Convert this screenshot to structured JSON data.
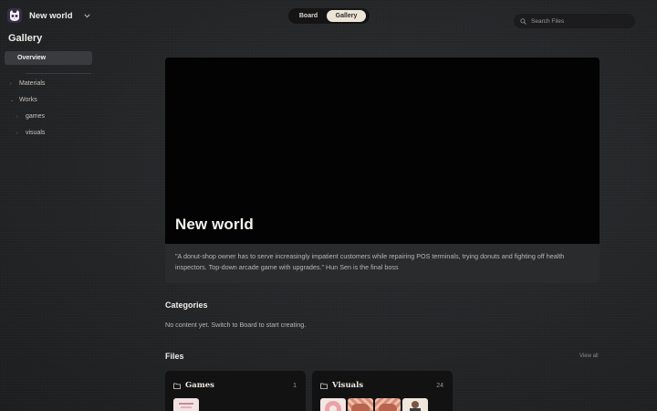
{
  "workspace": {
    "name": "New world",
    "logo_icon": "cat-logo-icon",
    "chevron_icon": "chevron-down-icon"
  },
  "sidebar": {
    "title": "Gallery",
    "overview": "Overview",
    "items": [
      {
        "label": "Materials"
      },
      {
        "label": "Works"
      },
      {
        "label": "games"
      },
      {
        "label": "visuals"
      }
    ]
  },
  "view_toggle": {
    "board": "Board",
    "gallery": "Gallery",
    "active": "gallery"
  },
  "search": {
    "placeholder": "Search Files",
    "value": ""
  },
  "hero": {
    "title": "New world",
    "description": "\"A donut-shop owner has to serve increasingly impatient customers while repairing POS terminals, trying donuts and fighting off health inspectors. Top-down arcade game with upgrades.\" Hun Sen is the final boss"
  },
  "categories": {
    "title": "Categories",
    "empty_text": "No content yet. Switch to Board to start creating."
  },
  "files": {
    "title": "Files",
    "view_all": "View all",
    "cards": [
      {
        "name": "Games",
        "count": "1",
        "icon": "folder-icon"
      },
      {
        "name": "Visuals",
        "count": "24",
        "icon": "folder-icon"
      }
    ]
  },
  "colors": {
    "accent_toggle": "#ece5d7",
    "overview_bg": "#3a3b3e",
    "hero_banner": "#030303",
    "card_bg": "#121213"
  }
}
